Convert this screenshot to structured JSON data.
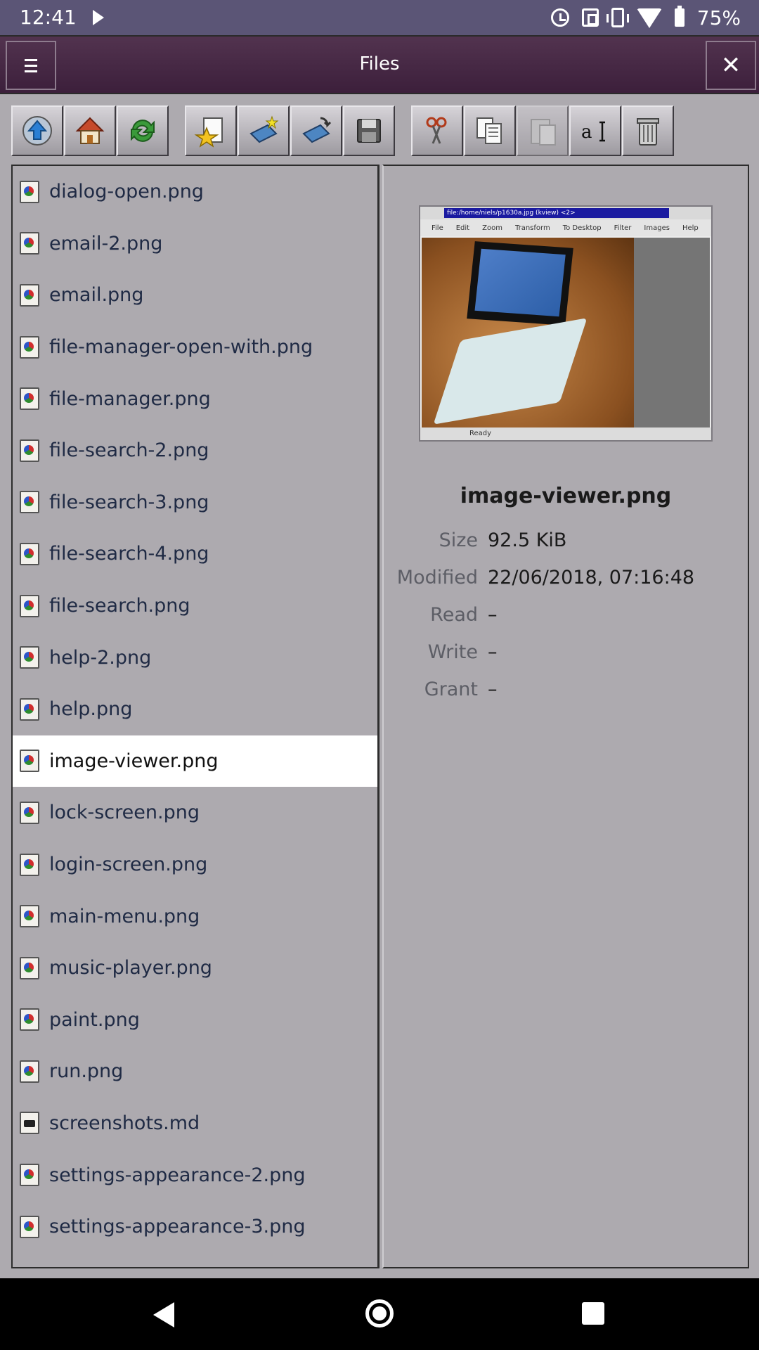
{
  "status_bar": {
    "time": "12:41",
    "battery_percent": "75%",
    "icons": [
      "play-icon",
      "alarm-icon",
      "nfc-icon",
      "vibrate-icon",
      "wifi-icon",
      "battery-icon"
    ]
  },
  "window": {
    "title": "Files",
    "close_glyph": "✕"
  },
  "toolbar": {
    "buttons": [
      {
        "name": "go-up-button",
        "icon": "up-arrow-icon",
        "enabled": true
      },
      {
        "name": "home-button",
        "icon": "home-icon",
        "enabled": true
      },
      {
        "name": "refresh-button",
        "icon": "refresh-icon",
        "enabled": true
      },
      {
        "name": "bookmark-button",
        "icon": "bookmark-icon",
        "enabled": true
      },
      {
        "name": "new-folder-button",
        "icon": "new-folder-icon",
        "enabled": true
      },
      {
        "name": "open-folder-button",
        "icon": "open-folder-icon",
        "enabled": true
      },
      {
        "name": "save-button",
        "icon": "floppy-icon",
        "enabled": true
      },
      {
        "name": "cut-button",
        "icon": "scissors-icon",
        "enabled": true
      },
      {
        "name": "copy-button",
        "icon": "copy-icon",
        "enabled": true
      },
      {
        "name": "paste-button",
        "icon": "paste-icon",
        "enabled": false
      },
      {
        "name": "rename-button",
        "icon": "rename-icon",
        "enabled": true
      },
      {
        "name": "delete-button",
        "icon": "trash-icon",
        "enabled": true
      }
    ]
  },
  "file_list": {
    "partial_top": "dialog-open.png",
    "items": [
      {
        "name": "dialog-open.png",
        "type": "image"
      },
      {
        "name": "email-2.png",
        "type": "image"
      },
      {
        "name": "email.png",
        "type": "image"
      },
      {
        "name": "file-manager-open-with.png",
        "type": "image"
      },
      {
        "name": "file-manager.png",
        "type": "image"
      },
      {
        "name": "file-search-2.png",
        "type": "image"
      },
      {
        "name": "file-search-3.png",
        "type": "image"
      },
      {
        "name": "file-search-4.png",
        "type": "image"
      },
      {
        "name": "file-search.png",
        "type": "image"
      },
      {
        "name": "help-2.png",
        "type": "image"
      },
      {
        "name": "help.png",
        "type": "image"
      },
      {
        "name": "image-viewer.png",
        "type": "image",
        "selected": true
      },
      {
        "name": "lock-screen.png",
        "type": "image"
      },
      {
        "name": "login-screen.png",
        "type": "image"
      },
      {
        "name": "main-menu.png",
        "type": "image"
      },
      {
        "name": "music-player.png",
        "type": "image"
      },
      {
        "name": "paint.png",
        "type": "image"
      },
      {
        "name": "run.png",
        "type": "image"
      },
      {
        "name": "screenshots.md",
        "type": "text"
      },
      {
        "name": "settings-appearance-2.png",
        "type": "image"
      },
      {
        "name": "settings-appearance-3.png",
        "type": "image"
      }
    ]
  },
  "details": {
    "file_name": "image-viewer.png",
    "preview": {
      "window_title": "file:/home/niels/p1630a.jpg (kview) <2>",
      "menu": [
        "File",
        "Edit",
        "Zoom",
        "Transform",
        "To Desktop",
        "Filter",
        "Images",
        "Help"
      ],
      "status": "Ready"
    },
    "rows": [
      {
        "key": "Size",
        "value": "92.5 KiB"
      },
      {
        "key": "Modified",
        "value": "22/06/2018, 07:16:48"
      },
      {
        "key": "Read",
        "value": "–"
      },
      {
        "key": "Write",
        "value": "–"
      },
      {
        "key": "Grant",
        "value": "–"
      }
    ]
  },
  "colors": {
    "status_bar": "#5b5576",
    "title_bar": "#3c1f3b",
    "window_bg": "#adaaaf",
    "selected_row": "#ffffff",
    "file_text": "#1f2a44"
  }
}
